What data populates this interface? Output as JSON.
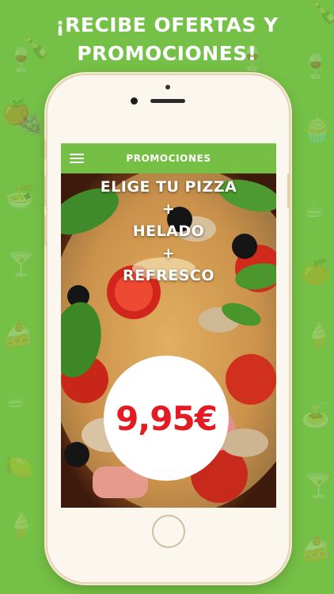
{
  "headline": {
    "line1": "¡RECIBE OFERTAS Y",
    "line2": "PROMOCIONES!"
  },
  "app_bar": {
    "title": "PROMOCIONES",
    "menu_icon": "hamburger-menu-icon"
  },
  "promo": {
    "line1": "ELIGE TU PIZZA",
    "plus1": "+",
    "line2": "HELADO",
    "plus2": "+",
    "line3": "REFRESCO",
    "price": "9,95€"
  },
  "colors": {
    "background_green": "#75c046",
    "app_bar_green": "#75bf44",
    "price_red": "#e31b23"
  },
  "background_icons": [
    "wine-glass-icon",
    "bottle-icon",
    "apple-icon",
    "grapes-icon",
    "pasta-bowl-icon",
    "cocktail-icon",
    "citrus-slice-icon",
    "cake-icon",
    "coffee-cup-icon",
    "ice-cream-icon",
    "cupcake-icon",
    "wine-bottle-icon"
  ]
}
